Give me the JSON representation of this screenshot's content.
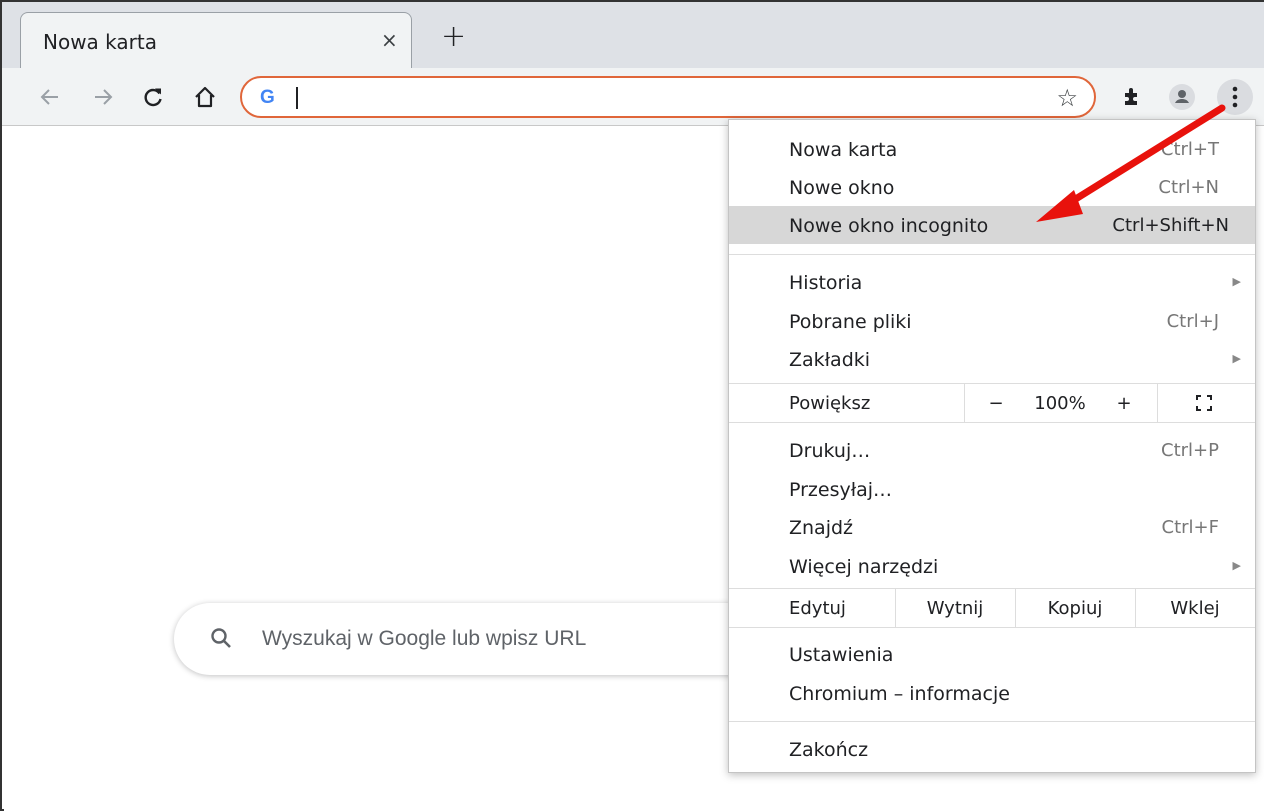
{
  "tab": {
    "title": "Nowa karta",
    "close_glyph": "×",
    "new_tab_glyph": "+"
  },
  "toolbar": {
    "icons": [
      "back-icon",
      "forward-icon",
      "reload-icon",
      "home-icon",
      "star-icon",
      "extensions-icon",
      "profile-icon",
      "menu-icon"
    ],
    "omnibox_value": "",
    "accent": "#e0663a"
  },
  "page": {
    "search_placeholder": "Wyszukaj w Google lub wpisz URL"
  },
  "menu": {
    "new_tab": {
      "label": "Nowa karta",
      "shortcut": "Ctrl+T"
    },
    "new_window": {
      "label": "Nowe okno",
      "shortcut": "Ctrl+N"
    },
    "incognito": {
      "label": "Nowe okno incognito",
      "shortcut": "Ctrl+Shift+N"
    },
    "history": {
      "label": "Historia"
    },
    "downloads": {
      "label": "Pobrane pliki",
      "shortcut": "Ctrl+J"
    },
    "bookmarks": {
      "label": "Zakładki"
    },
    "zoom": {
      "label": "Powiększ",
      "minus": "−",
      "value": "100%",
      "plus": "+"
    },
    "print": {
      "label": "Drukuj…",
      "shortcut": "Ctrl+P"
    },
    "cast": {
      "label": "Przesyłaj…"
    },
    "find": {
      "label": "Znajdź",
      "shortcut": "Ctrl+F"
    },
    "more_tools": {
      "label": "Więcej narzędzi"
    },
    "edit": {
      "label": "Edytuj",
      "cut": "Wytnij",
      "copy": "Kopiuj",
      "paste": "Wklej"
    },
    "settings": {
      "label": "Ustawienia"
    },
    "about": {
      "label": "Chromium – informacje"
    },
    "exit": {
      "label": "Zakończ"
    }
  },
  "annotation_color": "#e8120c"
}
